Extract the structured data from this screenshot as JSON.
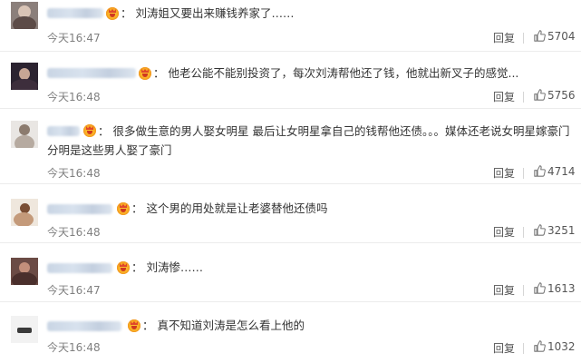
{
  "comments": [
    {
      "text": "：  刘涛姐又要出来赚钱养家了……",
      "time": "今天16:47",
      "reply_label": "回复",
      "likes": "5704"
    },
    {
      "text": "：  他老公能不能别投资了，每次刘涛帮他还了钱，他就出新叉子的感觉...",
      "time": "今天16:48",
      "reply_label": "回复",
      "likes": "5756"
    },
    {
      "text_line1": "：  很多做生意的男人娶女明星 最后让女明星拿自己的钱帮他还债。。。媒体还老说女明星嫁豪门",
      "text_line2": "分明是这些男人娶了豪门",
      "time": "今天16:48",
      "reply_label": "回复",
      "likes": "4714"
    },
    {
      "text": "：  这个男的用处就是让老婆替他还债吗",
      "time": "今天16:48",
      "reply_label": "回复",
      "likes": "3251"
    },
    {
      "text": "：  刘涛惨……",
      "time": "今天16:47",
      "reply_label": "回复",
      "likes": "1613"
    },
    {
      "text": "：  真不知道刘涛是怎么看上他的",
      "time": "今天16:48",
      "reply_label": "回复",
      "likes": "1032"
    }
  ],
  "icons": {
    "vip_badge": "crown-vip-icon",
    "like": "thumbs-up-icon"
  },
  "colors": {
    "text": "#333333",
    "time": "#808080",
    "divider": "#ececec",
    "vip_badge": "#f7a21b"
  }
}
